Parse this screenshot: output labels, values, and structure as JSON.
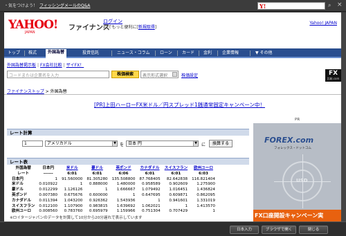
{
  "titlebar": {
    "notice": "・気をつけよう！",
    "notice_link": "フィッシングメールのQ&A",
    "search_logo": "Y!",
    "search_placeholder": "",
    "close": "×"
  },
  "header": {
    "logo": "YAHOO!",
    "logo_sub": "JAPAN",
    "service": "ファイナンス",
    "login_link": "ログイン",
    "login_sub": "IDでもっと便利に[",
    "register_link": "新規取得",
    "login_sub_end": "]",
    "top_link": "Yahoo! JAPAN"
  },
  "nav": {
    "items": [
      {
        "label": "トップ"
      },
      {
        "label": "株式"
      },
      {
        "label": "外国為替",
        "active": true
      },
      {
        "label": "投資信託"
      },
      {
        "label": "ニュース・コラム"
      },
      {
        "label": "ローン"
      },
      {
        "label": "カード"
      },
      {
        "label": "金利"
      },
      {
        "label": "企業情報"
      },
      {
        "label": "その他"
      }
    ]
  },
  "subnav": {
    "items": [
      "外国為替掲示板",
      "FX会社比較",
      "ザイFX！"
    ]
  },
  "search": {
    "placeholder": "コードまたは企業名を入力",
    "button": "株価検索",
    "market_placeholder": "表示形式選択",
    "settings_link": "株価設定"
  },
  "ad_small": {
    "text": "FX",
    "sub": "比較.com"
  },
  "breadcrumb": {
    "home": "ファイナンストップ",
    "sep": " > ",
    "current": "外国為替"
  },
  "promo": {
    "text": "[PR]上田ハーローFX米ドル／円スプレッド1銭通常固定キャンペーン中！"
  },
  "calc": {
    "title": "レート計算",
    "amount": "1",
    "from_currency": "アメリカドル",
    "wo": "を",
    "to_currency": "日本 円",
    "ni": "に",
    "button": "換算する"
  },
  "rates": {
    "title": "レート表",
    "corner": "外国為替",
    "corner_sub": "レート",
    "columns": [
      {
        "name": "日本円",
        "time": "------",
        "link": false
      },
      {
        "name": "米ドル",
        "time": "6:01",
        "link": true
      },
      {
        "name": "豪ドル",
        "time": "6:01",
        "link": true
      },
      {
        "name": "英ポンド",
        "time": "6:06",
        "link": true
      },
      {
        "name": "カナダドル",
        "time": "6:01",
        "link": true
      },
      {
        "name": "スイスフラン",
        "time": "6:01",
        "link": true
      },
      {
        "name": "欧州ユーロ",
        "time": "6:03",
        "link": true
      }
    ],
    "rows": [
      {
        "label": "日本円",
        "values": [
          "1",
          "91.560000",
          "81.305280",
          "135.508800",
          "87.768405",
          "82.642838",
          "116.821404"
        ]
      },
      {
        "label": "米ドル",
        "values": [
          "0.010922",
          "1",
          "0.888000",
          "1.480000",
          "0.958589",
          "0.902609",
          "1.275900"
        ]
      },
      {
        "label": "豪ドル",
        "values": [
          "0.012299",
          "1.126126",
          "1",
          "1.666667",
          "1.079492",
          "1.016451",
          "1.436824"
        ]
      },
      {
        "label": "英ポンド",
        "values": [
          "0.007380",
          "0.675676",
          "0.600000",
          "1",
          "0.647695",
          "0.609871",
          "0.862095"
        ]
      },
      {
        "label": "カナダドル",
        "values": [
          "0.011394",
          "1.043200",
          "0.926362",
          "1.543936",
          "1",
          "0.941601",
          "1.331019"
        ]
      },
      {
        "label": "スイスフラン",
        "values": [
          "0.012100",
          "1.107900",
          "0.983815",
          "1.639692",
          "1.062021",
          "1",
          "1.413570"
        ]
      },
      {
        "label": "欧州ユーロ",
        "values": [
          "0.008560",
          "0.783760",
          "0.695979",
          "1.159966",
          "0.751304",
          "0.707429",
          "1"
        ]
      }
    ],
    "note": "※ロイタージャパンのデータを計算して10分から20分遅れで表示しています"
  },
  "side_ad": {
    "pr_label": "PR",
    "logo": "FOREX.com",
    "logo_sub": "フォレックス・ドットコム",
    "center": "USD",
    "band": "FX口座開設キャンペーン実"
  },
  "bottom": {
    "buttons": [
      "日本入力",
      "ブラウザで開く",
      "閉じる"
    ]
  }
}
